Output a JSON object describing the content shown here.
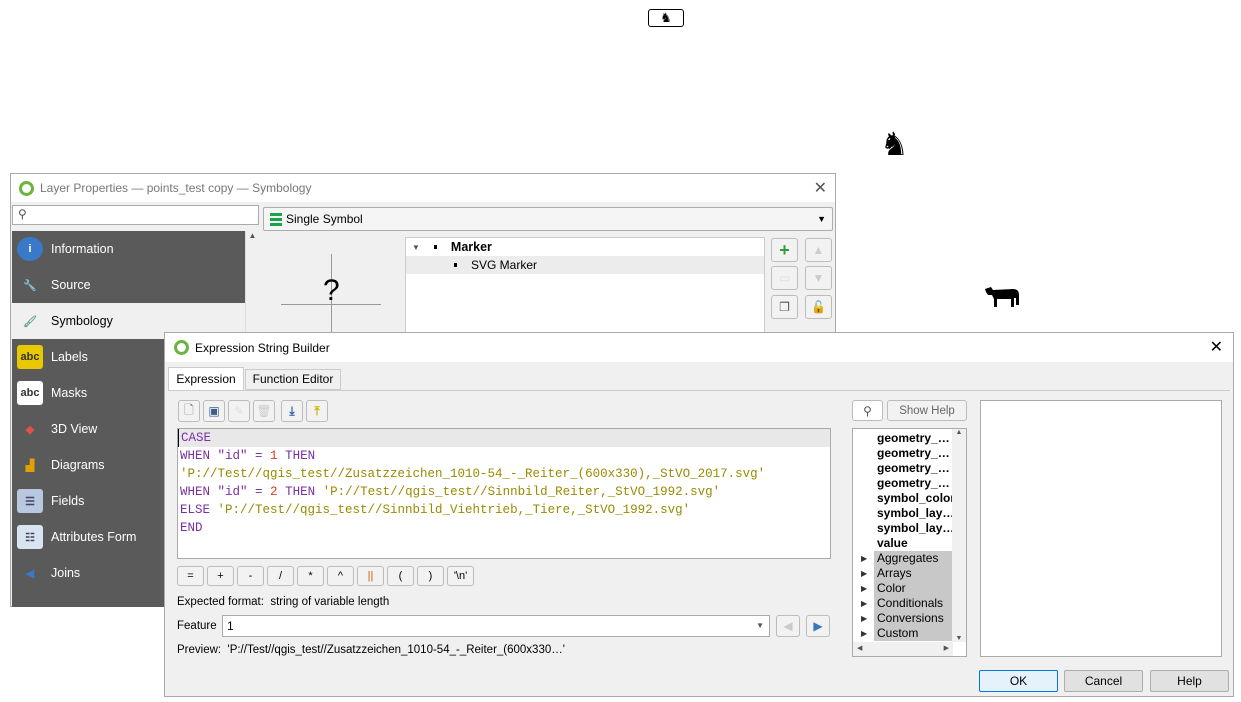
{
  "map": {
    "icons": [
      "horse-rider-sign-icon",
      "horse-rider-icon",
      "cow-icon"
    ]
  },
  "layer_props": {
    "title": "Layer Properties — points_test copy — Symbology",
    "search_placeholder": "",
    "renderer": "Single Symbol",
    "sidebar": [
      {
        "label": "Information",
        "icon": "information-icon"
      },
      {
        "label": "Source",
        "icon": "source-icon"
      },
      {
        "label": "Symbology",
        "icon": "symbology-icon",
        "selected": true
      },
      {
        "label": "Labels",
        "icon": "labels-icon"
      },
      {
        "label": "Masks",
        "icon": "masks-icon"
      },
      {
        "label": "3D View",
        "icon": "3d-view-icon"
      },
      {
        "label": "Diagrams",
        "icon": "diagrams-icon"
      },
      {
        "label": "Fields",
        "icon": "fields-icon"
      },
      {
        "label": "Attributes Form",
        "icon": "attributes-form-icon"
      },
      {
        "label": "Joins",
        "icon": "joins-icon"
      }
    ],
    "preview_glyph": "?",
    "tree": {
      "root": "Marker",
      "child": "SVG Marker"
    }
  },
  "expr": {
    "title": "Expression String Builder",
    "tabs": [
      "Expression",
      "Function Editor"
    ],
    "code": {
      "l1": "CASE",
      "l2_kw": "WHEN",
      "l2_fld": "\"id\" = ",
      "l2_num": "1",
      "l2_kw2": " THEN",
      "l3": "'P://Test//qgis_test//Zusatzzeichen_1010-54_-_Reiter_(600x330),_StVO_2017.svg'",
      "l4_kw": "WHEN",
      "l4_fld": "\"id\" = ",
      "l4_num": "2",
      "l4_kw2": " THEN ",
      "l4_str": "'P://Test//qgis_test//Sinnbild_Reiter,_StVO_1992.svg'",
      "l5_kw": "ELSE ",
      "l5_str": "'P://Test//qgis_test//Sinnbild_Viehtrieb,_Tiere,_StVO_1992.svg'",
      "l6": "END"
    },
    "operators": [
      "=",
      "+",
      "-",
      "/",
      "*",
      "^",
      "||",
      "(",
      ")",
      "'\\n'"
    ],
    "expected_label": "Expected format:",
    "expected_value": "string of variable length",
    "feature_label": "Feature",
    "feature_value": "1",
    "preview_label": "Preview:",
    "preview_value": "'P://Test//qgis_test//Zusatzzeichen_1010-54_-_Reiter_(600x330…'",
    "show_help": "Show Help",
    "functions": [
      "geometry_…",
      "geometry_…",
      "geometry_…",
      "geometry_…",
      "symbol_color",
      "symbol_lay…",
      "symbol_lay…",
      "value"
    ],
    "groups": [
      "Aggregates",
      "Arrays",
      "Color",
      "Conditionals",
      "Conversions",
      "Custom"
    ],
    "ok": "OK",
    "cancel": "Cancel",
    "help": "Help"
  }
}
